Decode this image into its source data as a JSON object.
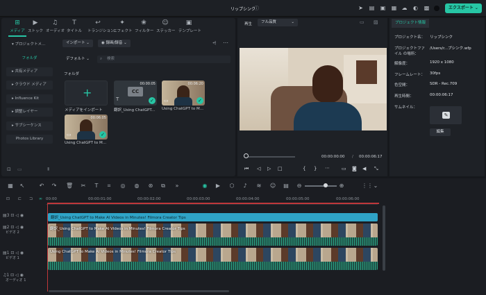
{
  "window": {
    "title": "リップシンク"
  },
  "export_button": {
    "label": "エクスポート"
  },
  "toolbar": {
    "tools": [
      {
        "label": "メディア",
        "icon": "media-icon"
      },
      {
        "label": "ストック",
        "icon": "stock-icon"
      },
      {
        "label": "オーディオ",
        "icon": "audio-icon"
      },
      {
        "label": "タイトル",
        "icon": "title-icon"
      },
      {
        "label": "トランジション",
        "icon": "transition-icon"
      },
      {
        "label": "エフェクト",
        "icon": "effect-icon"
      },
      {
        "label": "フィルター",
        "icon": "filter-icon"
      },
      {
        "label": "ステッカー",
        "icon": "sticker-icon"
      },
      {
        "label": "テンプレート",
        "icon": "template-icon"
      }
    ]
  },
  "sidebar": {
    "items": [
      {
        "label": "プロジェクトメ..."
      },
      {
        "label": "フォルダ"
      },
      {
        "label": "共有メディア"
      },
      {
        "label": "クラウド メディア"
      },
      {
        "label": "Influence Kit"
      },
      {
        "label": "調整レイヤー"
      },
      {
        "label": "サブシーケンス"
      },
      {
        "label": "Photos Library"
      }
    ]
  },
  "media": {
    "import_label": "インポート",
    "record_label": "録画/録音",
    "sort_label": "デフォルト",
    "search_placeholder": "検索",
    "folder_label": "フォルダ",
    "import_tile_label": "メディアをインポート",
    "items": [
      {
        "label": "翻訳_Using ChatGPT...",
        "duration": "00:00:05"
      },
      {
        "label": "Using ChatGPT to M...",
        "duration": "00:06:20"
      },
      {
        "label": "Using ChatGPT to M...",
        "duration": "00:06:05"
      }
    ]
  },
  "player": {
    "tab_label": "再生",
    "quality": "フル品質",
    "current_time": "00:00:00:00",
    "separator": "/",
    "total_time": "00:00:06:17"
  },
  "properties": {
    "tab_label": "プロジェクト情報",
    "rows": [
      {
        "label": "プロジェクト名：",
        "value": "リップシンク"
      },
      {
        "label": "プロジェクトファイル の場所：",
        "value": "/Users/r...プシンク.wfp"
      },
      {
        "label": "解像度：",
        "value": "1920 x 1080"
      },
      {
        "label": "フレームレート：",
        "value": "30fps"
      },
      {
        "label": "色空間：",
        "value": "SDR - Rec.709"
      },
      {
        "label": "再生時間：",
        "value": "00:00:06:17"
      },
      {
        "label": "サムネイル：",
        "value": ""
      }
    ],
    "edit_label": "編集"
  },
  "timeline": {
    "ticks": [
      "00:00",
      "00:00:01:00",
      "00:00:02:00",
      "00:00:03:00",
      "00:00:04:00",
      "00:00:05:00",
      "00:00:06:00"
    ],
    "tracks": [
      {
        "label": "ビデオ 2",
        "number": "2"
      },
      {
        "label": "ビデオ 1",
        "number": "1"
      },
      {
        "label": "オーディオ 1",
        "number": "1"
      }
    ],
    "clips": [
      {
        "label": "翻訳_Using ChatGPT to Make AI Videos in Minutes!  Filmora Creator Tips"
      },
      {
        "label": "翻訳_Using ChatGPT to Make AI Videos in Minutes!  Filmora Creator Tips"
      },
      {
        "label": "Using ChatGPT to Make AI Videos in Minutes!  Filmora Creator Tips"
      }
    ]
  },
  "colors": {
    "accent": "#27c6a5",
    "clip_blue": "#2fa3c6",
    "clip_green": "#1f4f45"
  }
}
